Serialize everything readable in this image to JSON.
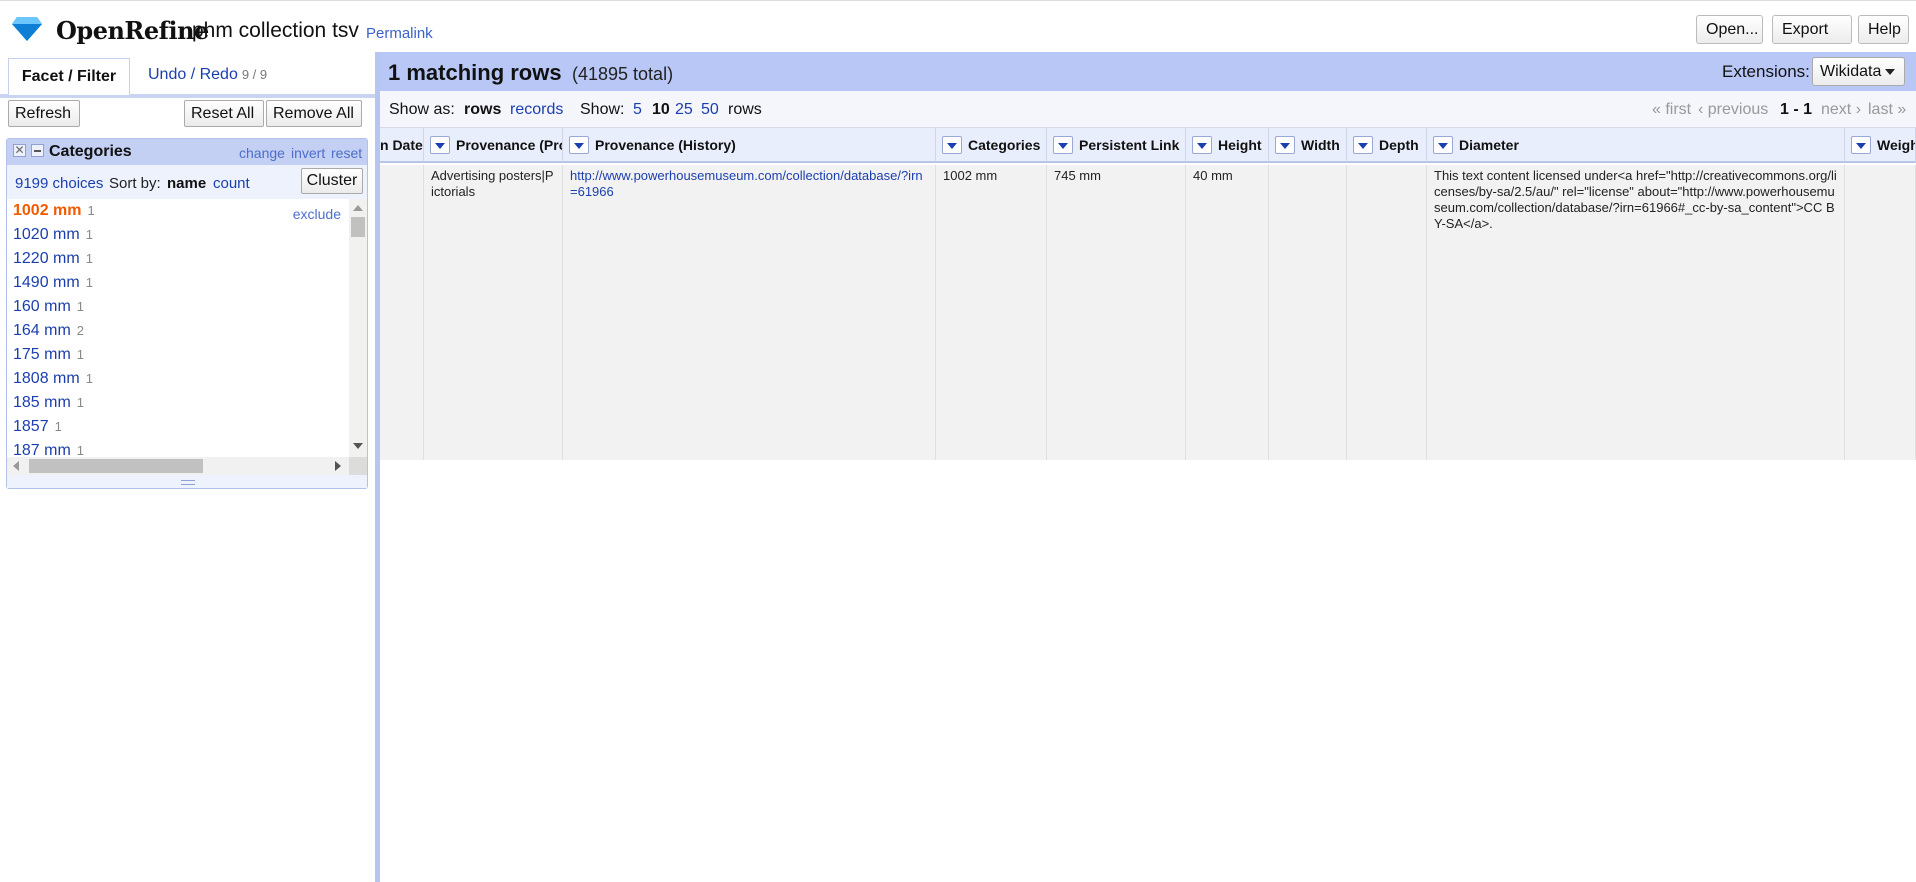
{
  "app": {
    "brand": "OpenRefine",
    "project_name": "phm collection tsv",
    "permalink": "Permalink",
    "buttons": {
      "open": "Open...",
      "export": "Export",
      "help": "Help"
    }
  },
  "left_panel": {
    "tabs": {
      "facet": "Facet / Filter",
      "undo": "Undo / Redo",
      "undo_count": "9 / 9"
    },
    "buttons": {
      "refresh": "Refresh",
      "reset_all": "Reset All",
      "remove_all": "Remove All"
    },
    "facet": {
      "title": "Categories",
      "links": {
        "change": "change",
        "invert": "invert",
        "reset": "reset"
      },
      "choices_count": "9199 choices",
      "sort_label": "Sort by:",
      "sort_name": "name",
      "sort_count": "count",
      "cluster": "Cluster",
      "exclude": "exclude",
      "choices": [
        {
          "label": "1002 mm",
          "count": "1",
          "selected": true
        },
        {
          "label": "1020 mm",
          "count": "1"
        },
        {
          "label": "1220 mm",
          "count": "1"
        },
        {
          "label": "1490 mm",
          "count": "1"
        },
        {
          "label": "160 mm",
          "count": "1"
        },
        {
          "label": "164 mm",
          "count": "2"
        },
        {
          "label": "175 mm",
          "count": "1"
        },
        {
          "label": "1808 mm",
          "count": "1"
        },
        {
          "label": "185 mm",
          "count": "1"
        },
        {
          "label": "1857",
          "count": "1"
        },
        {
          "label": "187 mm",
          "count": "1"
        }
      ]
    }
  },
  "summary": {
    "matching": "1 matching rows",
    "total": "(41895 total)",
    "extensions_label": "Extensions:",
    "extensions_button": "Wikidata"
  },
  "view_bar": {
    "show_as_label": "Show as:",
    "rows": "rows",
    "records": "records",
    "show_label": "Show:",
    "sizes": [
      "5",
      "10",
      "25",
      "50"
    ],
    "rows_suffix": "rows",
    "pager": {
      "first": "« first",
      "previous": "‹ previous",
      "range": "1 - 1",
      "next": "next ›",
      "last": "last »"
    }
  },
  "grid": {
    "headers": [
      "n Date",
      "Provenance (Pro",
      "Provenance (History)",
      "Categories",
      "Persistent Link",
      "Height",
      "Width",
      "Depth",
      "Diameter",
      "Weigh"
    ],
    "row": [
      "",
      "Advertising posters|Pictorials",
      "http://www.powerhousemuseum.com/collection/database/?irn=61966",
      "1002 mm",
      "745 mm",
      "40 mm",
      "",
      "",
      "This text content licensed under<a href=\"http://creativecommons.org/licenses/by-sa/2.5/au/\" rel=\"license\" about=\"http://www.powerhousemuseum.com/collection/database/?irn=61966#_cc-by-sa_content\">CC BY-SA</a>.",
      ""
    ]
  },
  "colors": {
    "accent": "#1b3fae",
    "selected": "#f05b00",
    "bar": "#b8c7f6"
  }
}
